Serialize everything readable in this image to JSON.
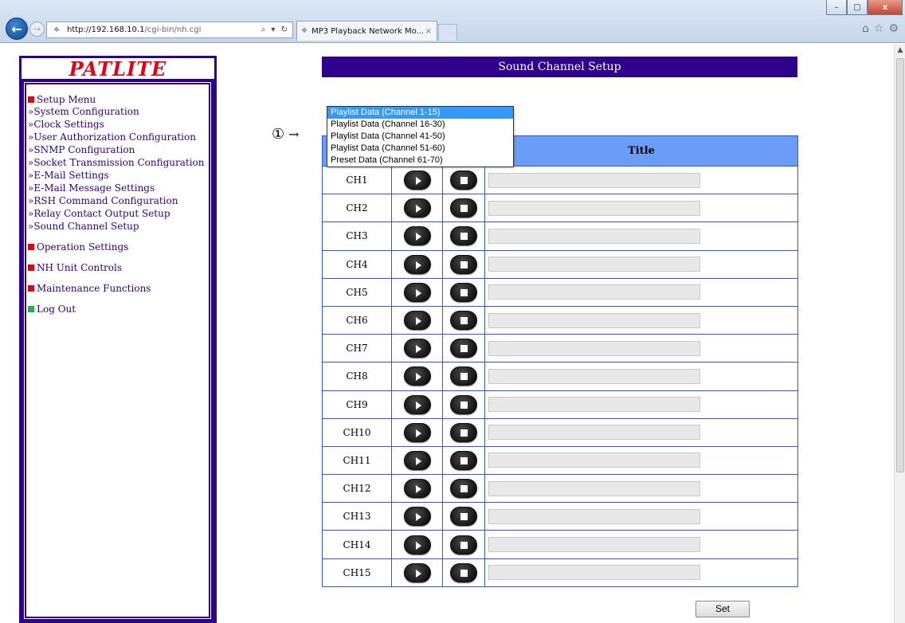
{
  "browser": {
    "address_host": "http://192.168.10.1",
    "address_path": "/cgi-bin/nh.cgi",
    "address_tools": "⌕ ▾ ↻",
    "tab_title": "MP3 Playback Network Mo...",
    "tab_close": "×",
    "favicon": "❖",
    "win_min": "–",
    "win_max": "□",
    "win_close": "x",
    "tool_home": "⌂",
    "tool_fav": "☆",
    "tool_gear": "⚙",
    "back": "←",
    "forward": "→"
  },
  "sidebar": {
    "logo": "PATLITE",
    "setup_menu": "Setup Menu",
    "items": [
      "»System Configuration",
      "»Clock Settings",
      "»User Authorization Configuration",
      "»SNMP Configuration",
      "»Socket Transmission Configuration",
      "»E-Mail Settings",
      "»E-Mail Message Settings",
      "»RSH Command Configuration",
      "»Relay Contact Output Setup",
      "»Sound Channel Setup"
    ],
    "sections": [
      "Operation Settings",
      "NH Unit Controls",
      "Maintenance Functions"
    ],
    "logout": "Log Out"
  },
  "main": {
    "title": "Sound Channel Setup",
    "annotation_marker": "①",
    "annotation_arrow": "→",
    "dropdown": {
      "options": [
        "Playlist Data (Channel 1-15)",
        "Playlist Data (Channel 16-30)",
        "Playlist Data (Channel 41-50)",
        "Playlist Data (Channel 51-60)",
        "Preset Data (Channel 61-70)"
      ],
      "selected_index": 0
    },
    "table": {
      "title_header": "Title",
      "rows": [
        "CH1",
        "CH2",
        "CH3",
        "CH4",
        "CH5",
        "CH6",
        "CH7",
        "CH8",
        "CH9",
        "CH10",
        "CH11",
        "CH12",
        "CH13",
        "CH14",
        "CH15"
      ]
    },
    "set_label": "Set"
  },
  "colors": {
    "brand_purple": "#2e008c",
    "logo_red": "#e60012",
    "header_blue": "#6b9cf8",
    "selected_option": "#3399ff"
  }
}
